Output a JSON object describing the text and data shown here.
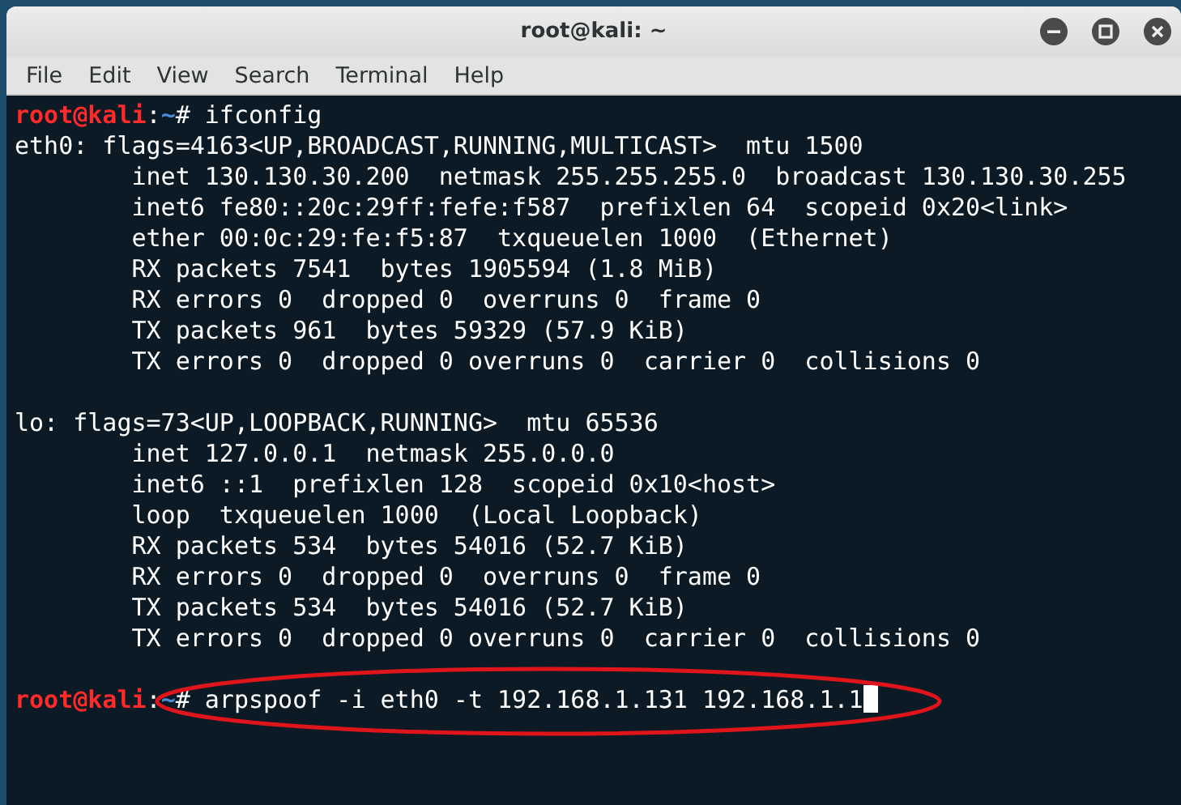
{
  "window": {
    "title": "root@kali: ~"
  },
  "menu": [
    "File",
    "Edit",
    "View",
    "Search",
    "Terminal",
    "Help"
  ],
  "terminal": {
    "lines": [
      {
        "kind": "prompt",
        "user_host": "root@kali",
        "separator": ":",
        "path": "~",
        "symbol": "#",
        "command": "ifconfig",
        "cursor": false,
        "highlighted": false
      },
      {
        "kind": "output",
        "text": "eth0: flags=4163<UP,BROADCAST,RUNNING,MULTICAST>  mtu 1500"
      },
      {
        "kind": "output",
        "text": "        inet 130.130.30.200  netmask 255.255.255.0  broadcast 130.130.30.255"
      },
      {
        "kind": "output",
        "text": "        inet6 fe80::20c:29ff:fefe:f587  prefixlen 64  scopeid 0x20<link>"
      },
      {
        "kind": "output",
        "text": "        ether 00:0c:29:fe:f5:87  txqueuelen 1000  (Ethernet)"
      },
      {
        "kind": "output",
        "text": "        RX packets 7541  bytes 1905594 (1.8 MiB)"
      },
      {
        "kind": "output",
        "text": "        RX errors 0  dropped 0  overruns 0  frame 0"
      },
      {
        "kind": "output",
        "text": "        TX packets 961  bytes 59329 (57.9 KiB)"
      },
      {
        "kind": "output",
        "text": "        TX errors 0  dropped 0 overruns 0  carrier 0  collisions 0"
      },
      {
        "kind": "blank"
      },
      {
        "kind": "output",
        "text": "lo: flags=73<UP,LOOPBACK,RUNNING>  mtu 65536"
      },
      {
        "kind": "output",
        "text": "        inet 127.0.0.1  netmask 255.0.0.0"
      },
      {
        "kind": "output",
        "text": "        inet6 ::1  prefixlen 128  scopeid 0x10<host>"
      },
      {
        "kind": "output",
        "text": "        loop  txqueuelen 1000  (Local Loopback)"
      },
      {
        "kind": "output",
        "text": "        RX packets 534  bytes 54016 (52.7 KiB)"
      },
      {
        "kind": "output",
        "text": "        RX errors 0  dropped 0  overruns 0  frame 0"
      },
      {
        "kind": "output",
        "text": "        TX packets 534  bytes 54016 (52.7 KiB)"
      },
      {
        "kind": "output",
        "text": "        TX errors 0  dropped 0 overruns 0  carrier 0  collisions 0"
      },
      {
        "kind": "blank"
      },
      {
        "kind": "prompt",
        "user_host": "root@kali",
        "separator": ":",
        "path": "~",
        "symbol": "#",
        "command": "arpspoof -i eth0 -t 192.168.1.131 192.168.1.1",
        "cursor": true,
        "highlighted": true
      }
    ]
  }
}
